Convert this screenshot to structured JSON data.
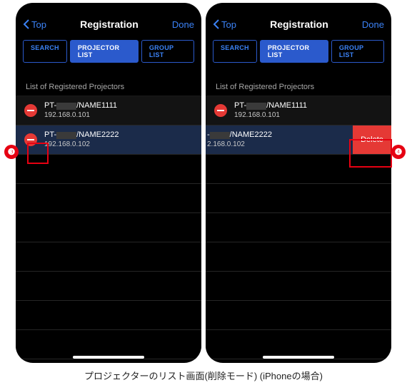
{
  "nav": {
    "back": "Top",
    "title": "Registration",
    "done": "Done"
  },
  "segments": {
    "search": "SEARCH",
    "projector": "PROJECTOR LIST",
    "group": "GROUP LIST"
  },
  "listHeader": "List of Registered Projectors",
  "projectors": [
    {
      "name_pre": "PT-",
      "name_post": "/NAME1111",
      "ip": "192.168.0.101"
    },
    {
      "name_pre": "PT-",
      "name_post": "/NAME2222",
      "ip": "192.168.0.102"
    }
  ],
  "rightSwiped": {
    "name_post": "/NAME2222",
    "ip": "2.168.0.102"
  },
  "deleteLabel": "Delete",
  "caption": "プロジェクターのリスト画面(削除モード) (iPhoneの場合)",
  "callouts": {
    "c3": "❸",
    "c4": "❹"
  }
}
